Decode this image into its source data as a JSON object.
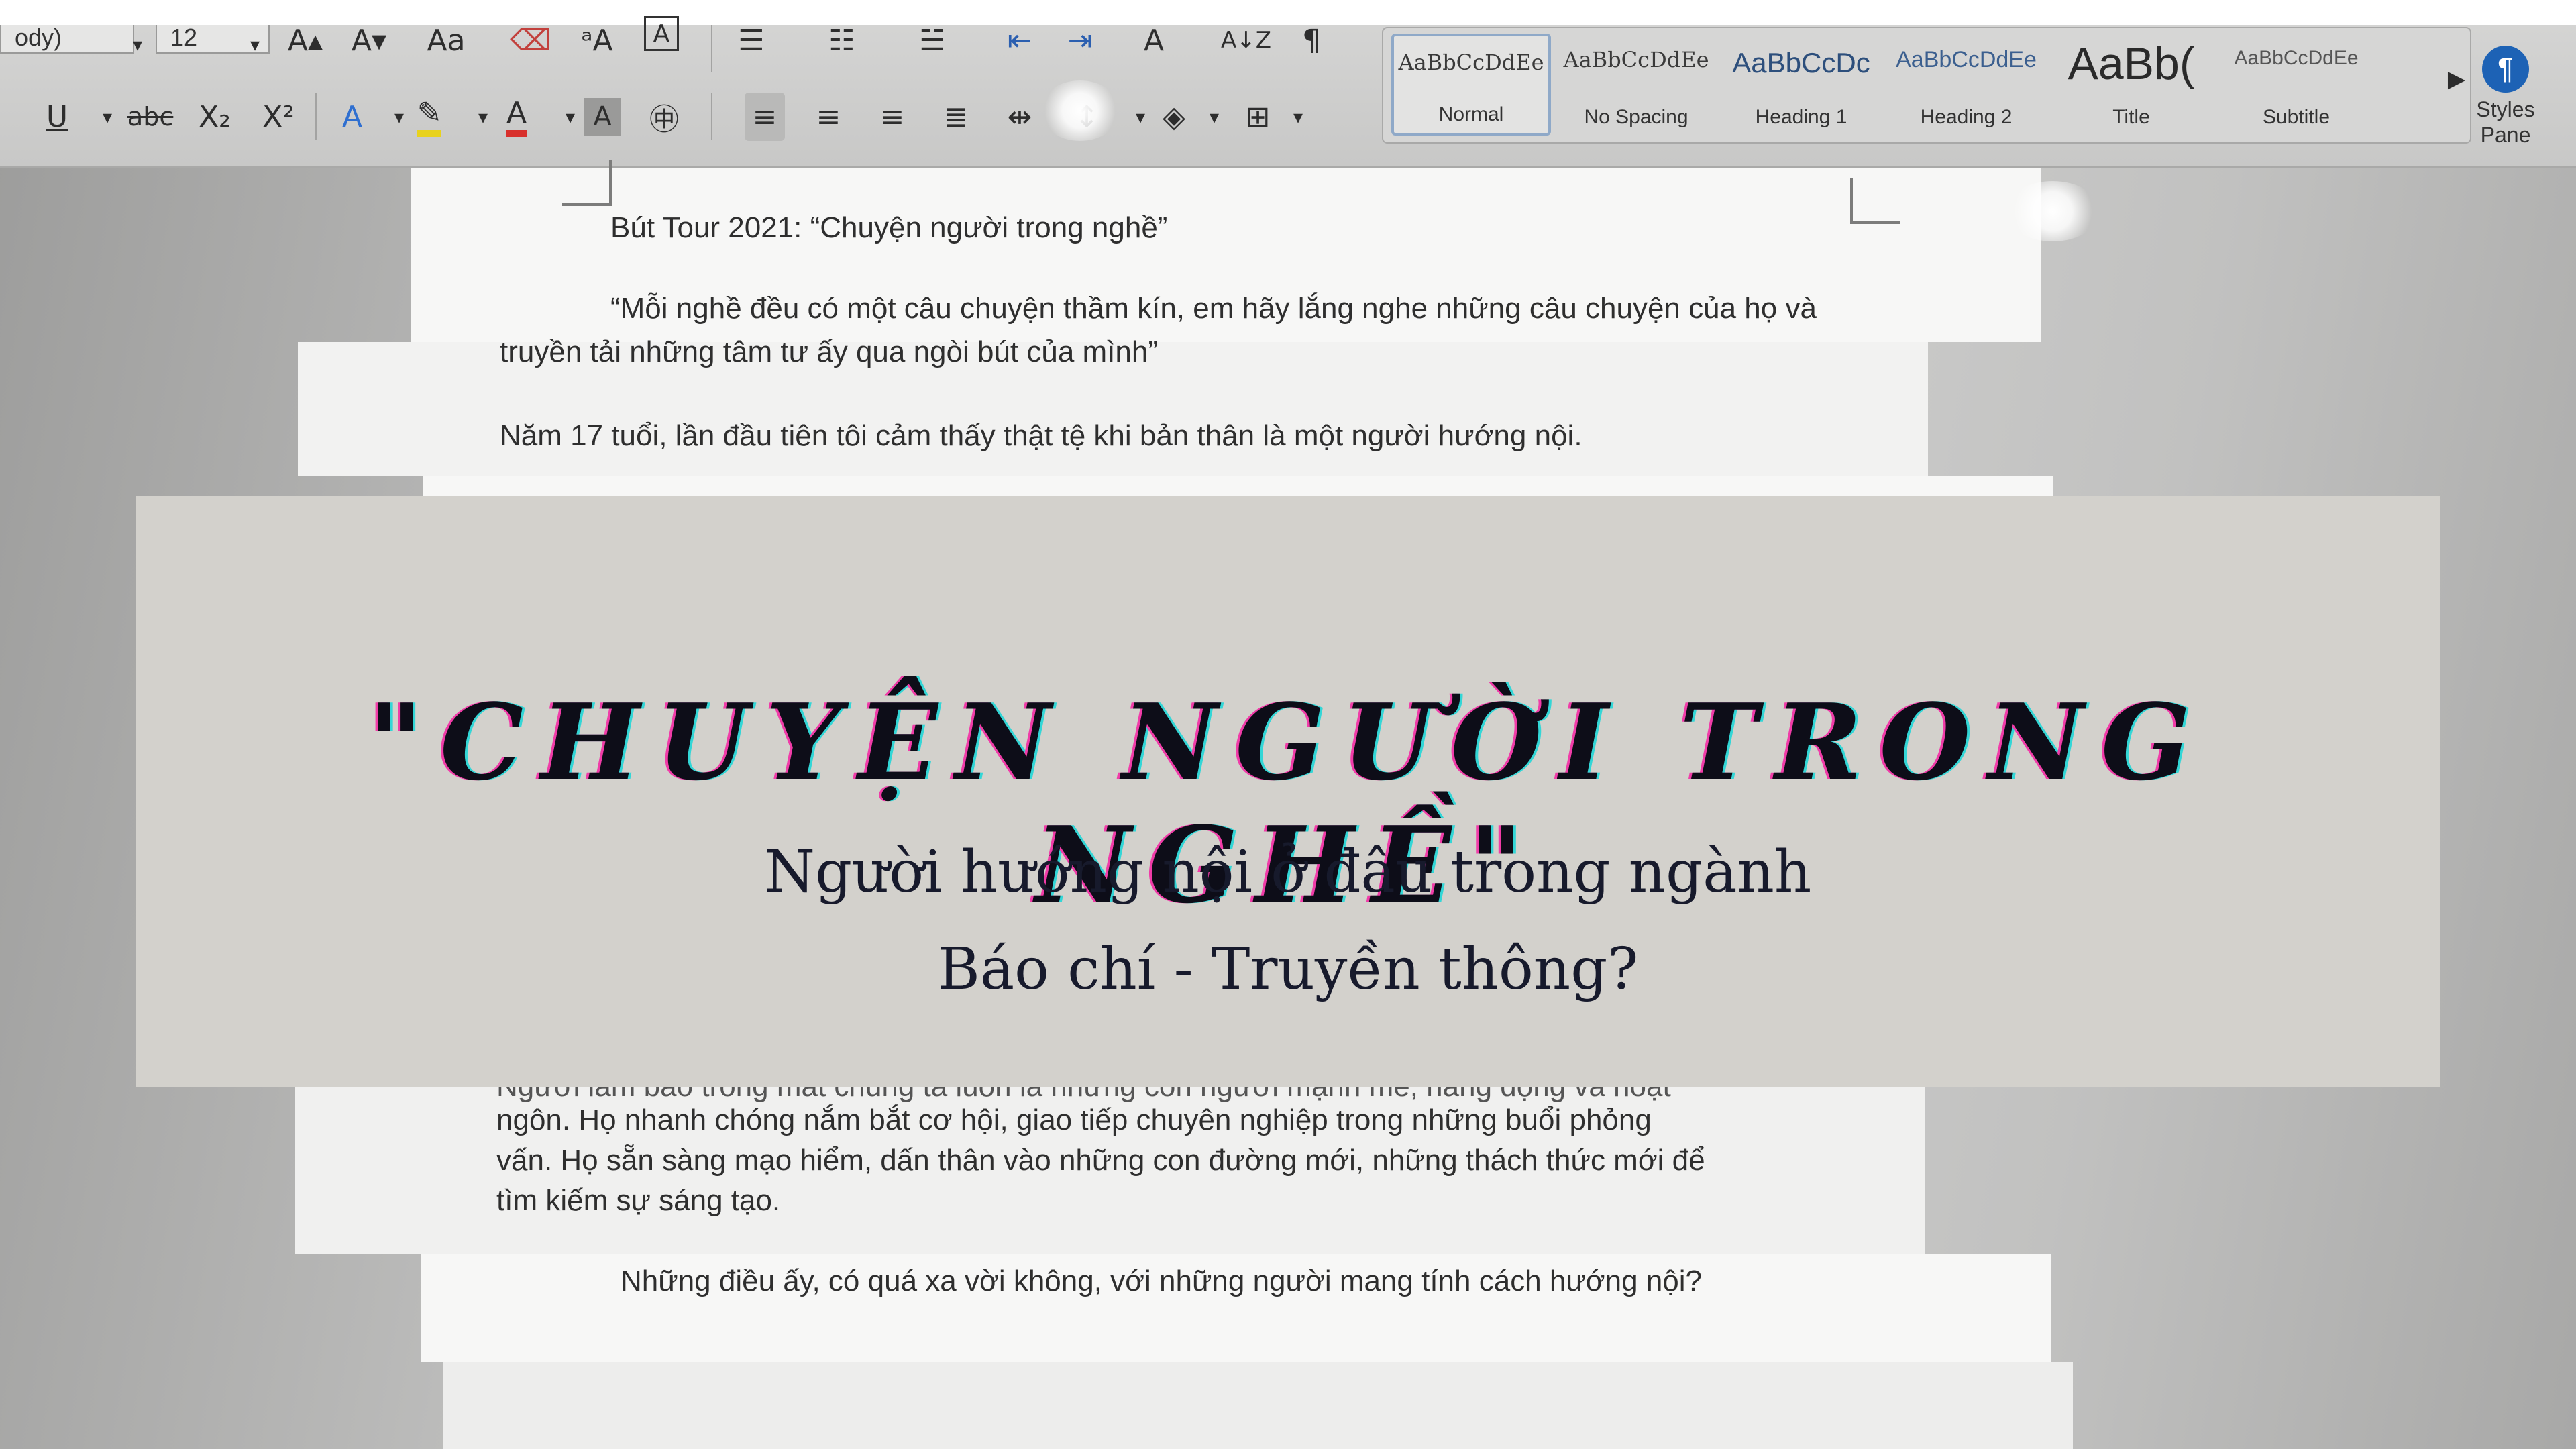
{
  "ribbon": {
    "font_name": "ody)",
    "font_size": "12",
    "tool_labels": {
      "grow_font": "A▴",
      "shrink_font": "A▾",
      "change_case": "Aa",
      "strikethrough": "abc",
      "subscript": "X₂",
      "superscript": "X²",
      "underline": "U",
      "sort": "A↓Z",
      "pilcrow": "¶",
      "font_color": "A",
      "char_shading": "A"
    },
    "styles": [
      {
        "preview": "AaBbCcDdEe",
        "label": "Normal",
        "selected": true
      },
      {
        "preview": "AaBbCcDdEe",
        "label": "No Spacing",
        "selected": false
      },
      {
        "preview": "AaBbCcDc",
        "label": "Heading 1",
        "selected": false
      },
      {
        "preview": "AaBbCcDdEe",
        "label": "Heading 2",
        "selected": false
      },
      {
        "preview": "AaBb(",
        "label": "Title",
        "selected": false
      },
      {
        "preview": "AaBbCcDdEe",
        "label": "Subtitle",
        "selected": false
      }
    ],
    "styles_pane": {
      "line1": "Styles",
      "line2": "Pane"
    }
  },
  "document": {
    "heading": "Bút Tour 2021: “Chuyện người trong nghề”",
    "quote_line1": "“Mỗi nghề đều có một câu chuyện thầm kín, em hãy lắng nghe những câu chuyện của họ và",
    "quote_line2": "truyền tải những tâm tư ấy qua ngòi bút của mình”",
    "para1": "Năm 17 tuổi, lần đầu tiên tôi cảm thấy thật tệ khi bản thân là một người hướng nội.",
    "para2_line1": "Người làm báo trong mắt chúng ta luôn là những con người mạnh mẽ, năng động và hoạt",
    "para2_line2": "ngôn. Họ nhanh chóng nắm bắt cơ hội, giao tiếp chuyên nghiệp trong những buổi phỏng",
    "para2_line3": "vấn. Họ sẵn sàng mạo hiểm, dấn thân vào những con đường mới, những thách thức mới để",
    "para2_line4": "tìm kiếm sự sáng tạo.",
    "para3": "Những điều ấy, có quá xa vời không, với những người mang tính cách hướng nội?"
  },
  "overlay": {
    "title": "\"CHUYỆN NGƯỜI TRONG NGHỀ\"",
    "subtitle_line1": "Người hướng nội ở đâu trong ngành",
    "subtitle_line2": "Báo chí - Truyền thông?"
  },
  "colors": {
    "card_bg": "#d3d1cc",
    "title_text": "#0d0d18",
    "title_shadow_pink": "#f03ca8",
    "title_shadow_cyan": "#33d6d6",
    "highlighter_yellow": "#e8d21d",
    "font_color_red": "#d8302c",
    "styles_pane_icon": "#1d62b5"
  }
}
